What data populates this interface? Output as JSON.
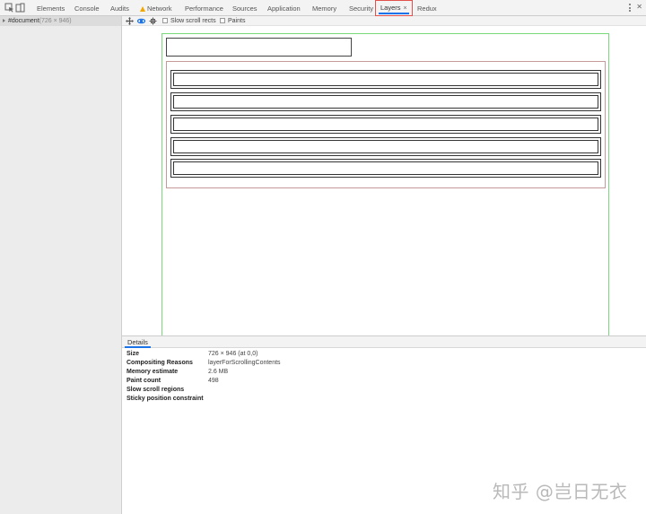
{
  "tabs": [
    {
      "label": "Elements"
    },
    {
      "label": "Console"
    },
    {
      "label": "Audits"
    },
    {
      "label": "Network",
      "icon": "warning-icon"
    },
    {
      "label": "Performance"
    },
    {
      "label": "Sources"
    },
    {
      "label": "Application"
    },
    {
      "label": "Memory"
    },
    {
      "label": "Security"
    },
    {
      "label": "Layers",
      "active": true,
      "close": "×"
    },
    {
      "label": "Redux"
    }
  ],
  "sidebar": {
    "root": {
      "name": "#document",
      "size": "(726 × 946)"
    }
  },
  "layers_toolbar": {
    "slow_scroll_rects": "Slow scroll rects",
    "paints": "Paints",
    "slow_scroll_checked": false,
    "paints_checked": false
  },
  "canvas": {
    "list_item_count": 5
  },
  "details": {
    "tab": "Details",
    "rows": [
      {
        "key": "Size",
        "value": "726 × 946 (at 0,0)"
      },
      {
        "key": "Compositing Reasons",
        "value": "layerForScrollingContents"
      },
      {
        "key": "Memory estimate",
        "value": "2.6 MB"
      },
      {
        "key": "Paint count",
        "value": "498"
      },
      {
        "key": "Slow scroll regions",
        "value": ""
      },
      {
        "key": "Sticky position constraint",
        "value": ""
      }
    ]
  },
  "watermark": "知乎 @岂日无衣",
  "colors": {
    "accent": "#1a73e8",
    "active_tab_outline": "#e0524b",
    "document_layer_border": "#7ad97a",
    "list_layer_border": "#c79a9a",
    "warning": "#f2a600"
  }
}
